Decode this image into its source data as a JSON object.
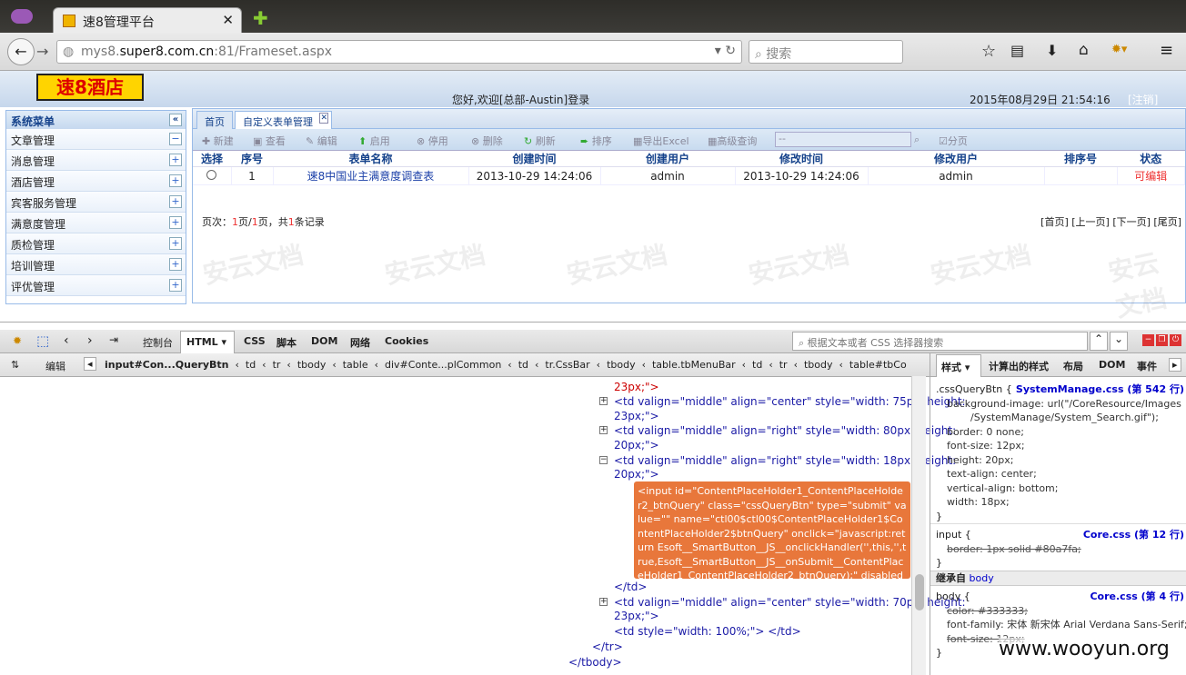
{
  "browser": {
    "tab_title": "速8管理平台",
    "url_host_pre": "mys8.",
    "url_host": "super8.com.cn",
    "url_rest": ":81/Frameset.aspx",
    "search_placeholder": "搜索"
  },
  "header": {
    "logo_text": "速8酒店",
    "welcome": "您好,欢迎[总部-Austin]登录",
    "datetime": "2015年08月29日 21:54:16",
    "logout": "[注销]"
  },
  "sidebar": {
    "title": "系统菜单",
    "items": [
      {
        "label": "文章管理",
        "sign": "−"
      },
      {
        "label": "消息管理",
        "sign": "+"
      },
      {
        "label": "酒店管理",
        "sign": "+"
      },
      {
        "label": "宾客服务管理",
        "sign": "+"
      },
      {
        "label": "满意度管理",
        "sign": "+"
      },
      {
        "label": "质检管理",
        "sign": "+"
      },
      {
        "label": "培训管理",
        "sign": "+"
      },
      {
        "label": "评优管理",
        "sign": "+"
      }
    ]
  },
  "tabs": {
    "home": "首页",
    "active": "自定义表单管理"
  },
  "toolbar": {
    "new": "新建",
    "view": "查看",
    "edit": "编辑",
    "enable": "启用",
    "disable": "停用",
    "delete": "删除",
    "refresh": "刷新",
    "sort": "排序",
    "export": "导出Excel",
    "advanced": "高级查询",
    "search_value": "--",
    "paging": "分页"
  },
  "table": {
    "headers": [
      "选择",
      "序号",
      "表单名称",
      "创建时间",
      "创建用户",
      "修改时间",
      "修改用户",
      "排序号",
      "状态"
    ],
    "row": {
      "seq": "1",
      "name": "速8中国业主满意度调查表",
      "created": "2013-10-29 14:24:06",
      "creator": "admin",
      "modified": "2013-10-29 14:24:06",
      "modifier": "admin",
      "sort": "",
      "status": "可编辑"
    }
  },
  "pager": {
    "p1": "页次：",
    "cur": "1",
    "p2": "页/",
    "total": "1",
    "p3": "页，共",
    "count": "1",
    "p4": "条记录",
    "links": "[首页] [上一页] [下一页] [尾页]"
  },
  "watermark": "安云文档",
  "devtools": {
    "tabs": [
      "控制台",
      "HTML",
      "CSS",
      "脚本",
      "DOM",
      "网络",
      "Cookies"
    ],
    "search_placeholder": "根据文本或者 CSS 选择器搜索",
    "edit": "编辑",
    "crumbs": [
      "input#Con...QueryBtn",
      "td",
      "tr",
      "tbody",
      "table",
      "div#Conte...plCommon",
      "td",
      "tr.CssBar",
      "tbody",
      "table.tbMenuBar",
      "td",
      "tr",
      "tbody",
      "table#tbCo"
    ],
    "right_tabs": [
      "样式",
      "计算出的样式",
      "布局",
      "DOM",
      "事件"
    ],
    "code": [
      "23px;\">",
      "<td valign=\"middle\" align=\"center\" style=\"width: 75px; height:",
      "23px;\">",
      "<td valign=\"middle\" align=\"right\" style=\"width: 80px; height:",
      "20px;\">",
      "<td valign=\"middle\" align=\"right\" style=\"width: 18px; height:",
      "20px;\">",
      "</td>",
      "<td valign=\"middle\" align=\"center\" style=\"width: 70px; height:",
      "23px;\">",
      "<td style=\"width: 100%;\"> </td>",
      "</tr>",
      "</tbody>"
    ],
    "selected_node": "<input id=\"ContentPlaceHolder1_ContentPlaceHolder2_btnQuery\" class=\"cssQueryBtn\" type=\"submit\" value=\"\" name=\"ctl00$ctl00$ContentPlaceHolder1$ContentPlaceHolder2$btnQuery\" onclick=\"javascript:return Esoft__SmartButton__JS__onclickHandler('',this,'',true,Esoft__SmartButton__JS__onSubmit__ContentPlaceHolder1_ContentPlaceHolder2_btnQuery);\" disabled=\"\">",
    "styles": {
      "rule1_sel": ".cssQueryBtn {",
      "rule1_src": "SystemManage.css (第 542 行)",
      "rule1_props": [
        "background-image: url(\"/CoreResource/Images",
        "/SystemManage/System_Search.gif\");",
        "border: 0 none;",
        "font-size: 12px;",
        "height: 20px;",
        "text-align: center;",
        "vertical-align: bottom;",
        "width: 18px;"
      ],
      "close": "}",
      "rule2_sel": "input {",
      "rule2_src": "Core.css (第 12 行)",
      "rule2_prop": "border: 1px solid #80a7fa;",
      "inherit_label": "继承自",
      "inherit_from": "body",
      "rule3_sel": "body {",
      "rule3_src": "Core.css (第 4 行)",
      "rule3_props": [
        "color: #333333;",
        "font-family: 宋体 新宋体 Arial Verdana Sans-Serif;",
        "font-size: 12px;"
      ]
    }
  },
  "site_watermark": "www.wooyun.org",
  "colors": {
    "accent": "#15428b",
    "highlight": "#e8773b",
    "link": "#1a1aa6",
    "status": "#e33333"
  }
}
